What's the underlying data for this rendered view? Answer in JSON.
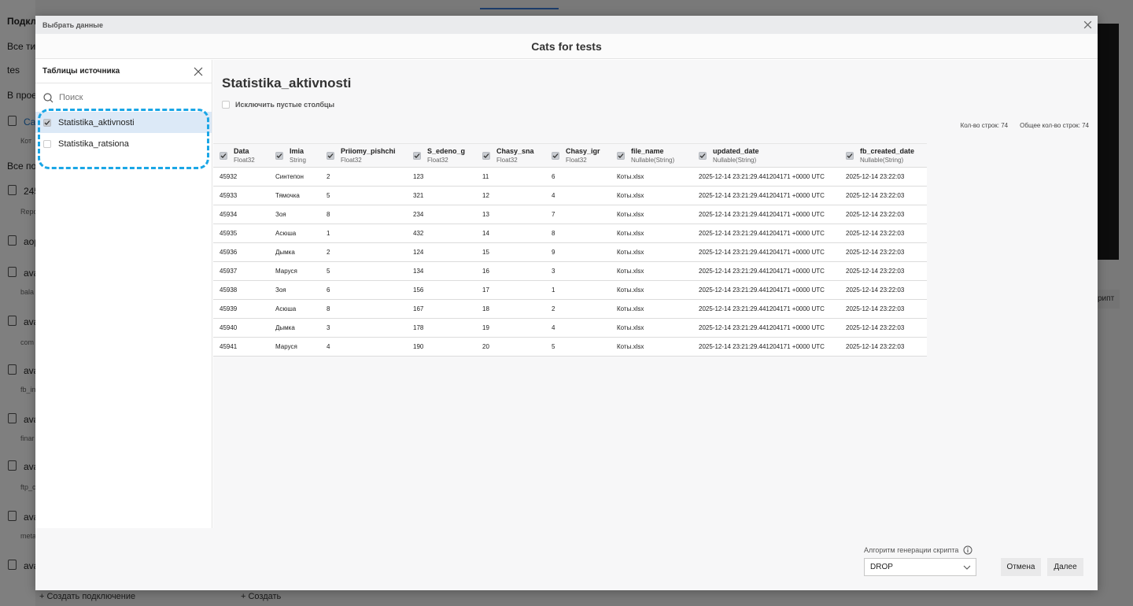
{
  "background": {
    "left_rows": [
      {
        "text": "Подкл",
        "bold": true
      },
      {
        "text": "Все тип"
      },
      {
        "text": "tes"
      },
      {
        "text": "В проект"
      },
      {
        "text": "Cat"
      },
      {
        "text": "Кот"
      },
      {
        "text": "Все под"
      },
      {
        "text": "245"
      },
      {
        "text": "Repo"
      },
      {
        "text": "aop"
      },
      {
        "text": "ava"
      },
      {
        "text": "bala"
      },
      {
        "text": "ava"
      },
      {
        "text": "com"
      },
      {
        "text": "ava"
      },
      {
        "text": "fb_in"
      },
      {
        "text": "ava"
      },
      {
        "text": "finar"
      },
      {
        "text": "ava"
      },
      {
        "text": "ftp_c"
      },
      {
        "text": "ava"
      },
      {
        "text": "meta"
      },
      {
        "text": "ava"
      }
    ],
    "right_button": "рипт",
    "create_connection": "+ Создать подключение",
    "create": "+ Создать"
  },
  "modal": {
    "window_title": "Выбрать данные",
    "header_title": "Cats for tests"
  },
  "sidebar": {
    "title": "Таблицы источника",
    "search_placeholder": "Поиск",
    "items": [
      {
        "label": "Statistika_aktivnosti",
        "checked": true,
        "active": true
      },
      {
        "label": "Statistika_ratsiona",
        "checked": false,
        "active": false
      }
    ]
  },
  "main": {
    "table_title": "Statistika_aktivnosti",
    "exclude_empty_label": "Исключить пустые столбцы",
    "row_count": "Кол-во строк: 74",
    "total_row_count": "Общее кол-во строк: 74",
    "columns": [
      {
        "name": "Data",
        "type": "Float32"
      },
      {
        "name": "Imia",
        "type": "String"
      },
      {
        "name": "Priiomy_pishchi",
        "type": "Float32"
      },
      {
        "name": "S_edeno_g",
        "type": "Float32"
      },
      {
        "name": "Chasy_sna",
        "type": "Float32"
      },
      {
        "name": "Chasy_igr",
        "type": "Float32"
      },
      {
        "name": "file_name",
        "type": "Nullable(String)"
      },
      {
        "name": "updated_date",
        "type": "Nullable(String)"
      },
      {
        "name": "fb_created_date",
        "type": "Nullable(String)"
      }
    ],
    "rows": [
      [
        "45932",
        "Синтепон",
        "2",
        "123",
        "11",
        "6",
        "Коты.xlsx",
        "2025-12-14 23:21:29.441204171 +0000 UTC",
        "2025-12-14 23:22:03"
      ],
      [
        "45933",
        "Тямочка",
        "5",
        "321",
        "12",
        "4",
        "Коты.xlsx",
        "2025-12-14 23:21:29.441204171 +0000 UTC",
        "2025-12-14 23:22:03"
      ],
      [
        "45934",
        "Зоя",
        "8",
        "234",
        "13",
        "7",
        "Коты.xlsx",
        "2025-12-14 23:21:29.441204171 +0000 UTC",
        "2025-12-14 23:22:03"
      ],
      [
        "45935",
        "Асюша",
        "1",
        "432",
        "14",
        "8",
        "Коты.xlsx",
        "2025-12-14 23:21:29.441204171 +0000 UTC",
        "2025-12-14 23:22:03"
      ],
      [
        "45936",
        "Дымка",
        "2",
        "124",
        "15",
        "9",
        "Коты.xlsx",
        "2025-12-14 23:21:29.441204171 +0000 UTC",
        "2025-12-14 23:22:03"
      ],
      [
        "45937",
        "Маруся",
        "5",
        "134",
        "16",
        "3",
        "Коты.xlsx",
        "2025-12-14 23:21:29.441204171 +0000 UTC",
        "2025-12-14 23:22:03"
      ],
      [
        "45938",
        "Зоя",
        "6",
        "156",
        "17",
        "1",
        "Коты.xlsx",
        "2025-12-14 23:21:29.441204171 +0000 UTC",
        "2025-12-14 23:22:03"
      ],
      [
        "45939",
        "Асюша",
        "8",
        "167",
        "18",
        "2",
        "Коты.xlsx",
        "2025-12-14 23:21:29.441204171 +0000 UTC",
        "2025-12-14 23:22:03"
      ],
      [
        "45940",
        "Дымка",
        "3",
        "178",
        "19",
        "4",
        "Коты.xlsx",
        "2025-12-14 23:21:29.441204171 +0000 UTC",
        "2025-12-14 23:22:03"
      ],
      [
        "45941",
        "Маруся",
        "4",
        "190",
        "20",
        "5",
        "Коты.xlsx",
        "2025-12-14 23:21:29.441204171 +0000 UTC",
        "2025-12-14 23:22:03"
      ]
    ]
  },
  "footer": {
    "algo_label": "Алгоритм генерации скрипта",
    "algo_value": "DROP",
    "cancel_label": "Отмена",
    "next_label": "Далее"
  },
  "colors": {
    "accent": "#1aa6e6",
    "active_row": "#dce9f7",
    "overlay": "rgba(0,0,0,0.5)"
  },
  "icons": {
    "close": "close-icon",
    "search": "search-icon",
    "info": "info-icon",
    "chevron": "chevron-down-icon",
    "check": "check-icon"
  }
}
